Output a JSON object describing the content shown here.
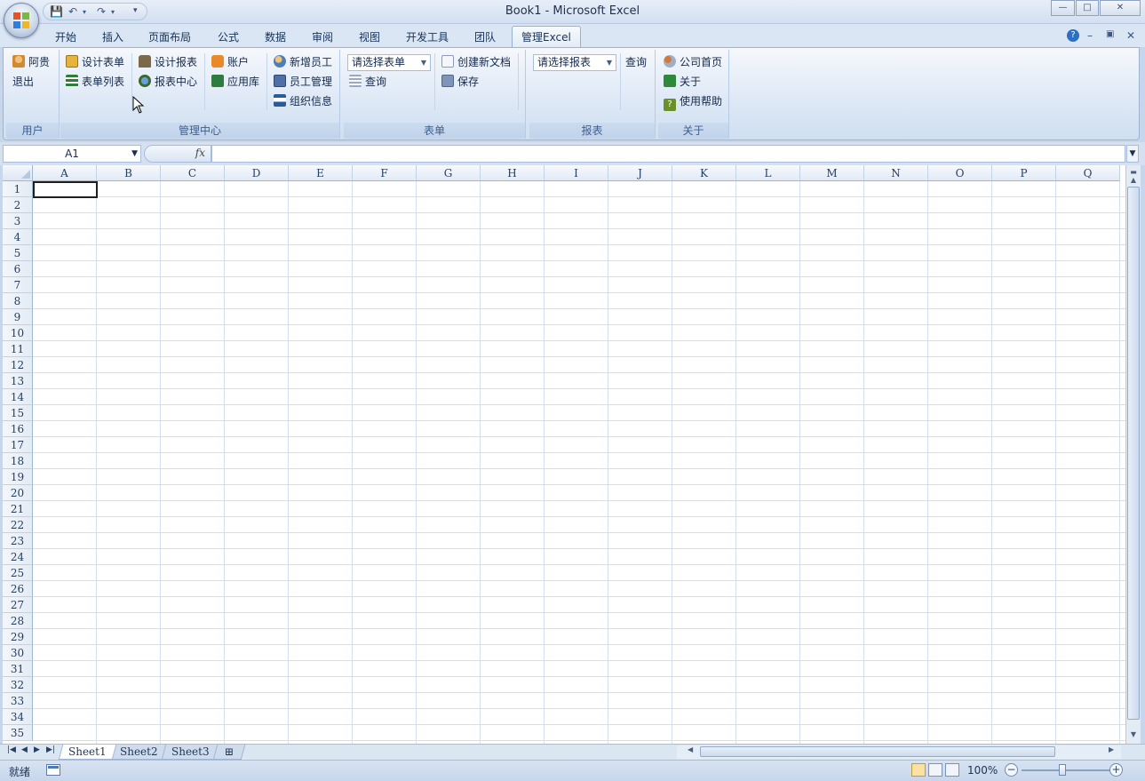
{
  "window": {
    "title": "Book1 - Microsoft Excel",
    "controls": [
      "—",
      "□",
      "✕"
    ]
  },
  "ribbon_tabs": [
    {
      "label": "开始"
    },
    {
      "label": "插入"
    },
    {
      "label": "页面布局"
    },
    {
      "label": "公式"
    },
    {
      "label": "数据"
    },
    {
      "label": "审阅"
    },
    {
      "label": "视图"
    },
    {
      "label": "开发工具"
    },
    {
      "label": "团队"
    },
    {
      "label": "管理Excel",
      "active": true
    }
  ],
  "ribbon": {
    "group_user": {
      "label": "用户",
      "user_name": "阿贵",
      "logout": "退出"
    },
    "group_manage": {
      "label": "管理中心",
      "design_form": "设计表单",
      "form_list": "表单列表",
      "design_report": "设计报表",
      "report_center": "报表中心",
      "account": "账户",
      "app_library": "应用库",
      "add_employee": "新增员工",
      "employee_manage": "员工管理",
      "org_info": "组织信息"
    },
    "group_form": {
      "label": "表单",
      "select_form": "请选择表单",
      "query": "查询",
      "create_doc": "创建新文档",
      "save": "保存"
    },
    "group_report": {
      "label": "报表",
      "select_report": "请选择报表",
      "query": "查询"
    },
    "group_about": {
      "label": "关于",
      "company_home": "公司首页",
      "about": "关于",
      "help": "使用帮助"
    }
  },
  "formula_bar": {
    "name_box": "A1",
    "fx": "fx",
    "formula": ""
  },
  "columns": [
    "A",
    "B",
    "C",
    "D",
    "E",
    "F",
    "G",
    "H",
    "I",
    "J",
    "K",
    "L",
    "M",
    "N",
    "O",
    "P",
    "Q"
  ],
  "rows": [
    "1",
    "2",
    "3",
    "4",
    "5",
    "6",
    "7",
    "8",
    "9",
    "10",
    "11",
    "12",
    "13",
    "14",
    "15",
    "16",
    "17",
    "18",
    "19",
    "20",
    "21",
    "22",
    "23",
    "24",
    "25",
    "26",
    "27",
    "28",
    "29",
    "30",
    "31",
    "32",
    "33",
    "34",
    "35"
  ],
  "sheet_tabs": [
    {
      "label": "Sheet1",
      "active": true
    },
    {
      "label": "Sheet2"
    },
    {
      "label": "Sheet3"
    }
  ],
  "status": {
    "ready": "就绪",
    "zoom": "100%"
  },
  "colors": {
    "accent": "#4d78b6",
    "ribbon_bg": "#dfe9f6"
  }
}
